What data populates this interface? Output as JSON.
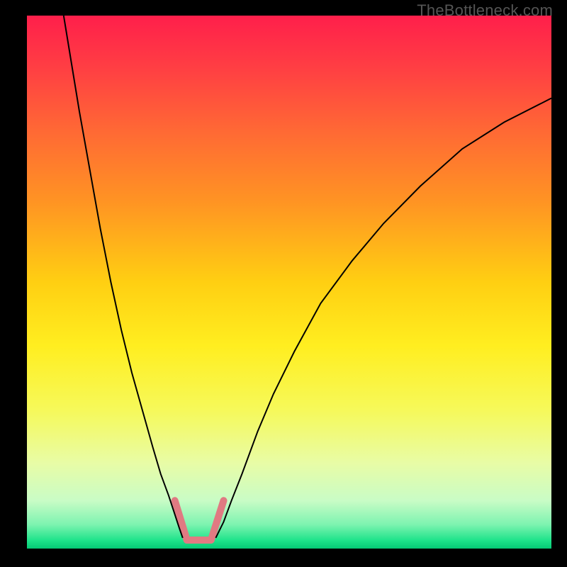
{
  "watermark": "TheBottleneck.com",
  "chart_data": {
    "type": "line",
    "title": "",
    "xlabel": "",
    "ylabel": "",
    "xlim": [
      0,
      100
    ],
    "ylim": [
      0,
      100
    ],
    "background": {
      "gradient_stops": [
        {
          "pos": 0.0,
          "color": "#ff1f4b"
        },
        {
          "pos": 0.1,
          "color": "#ff3f43"
        },
        {
          "pos": 0.22,
          "color": "#ff6a34"
        },
        {
          "pos": 0.35,
          "color": "#ff9423"
        },
        {
          "pos": 0.5,
          "color": "#ffcf12"
        },
        {
          "pos": 0.62,
          "color": "#ffee20"
        },
        {
          "pos": 0.74,
          "color": "#f6f95a"
        },
        {
          "pos": 0.84,
          "color": "#e8fca6"
        },
        {
          "pos": 0.91,
          "color": "#c9fcc6"
        },
        {
          "pos": 0.955,
          "color": "#7df3b0"
        },
        {
          "pos": 0.985,
          "color": "#1de38a"
        },
        {
          "pos": 1.0,
          "color": "#05c974"
        }
      ]
    },
    "series": [
      {
        "name": "left-curve",
        "stroke": "#000000",
        "x": [
          7.0,
          8.5,
          10.0,
          12.0,
          14.0,
          16.0,
          18.0,
          20.0,
          22.0,
          24.0,
          25.5,
          27.0,
          28.0,
          29.0,
          29.7
        ],
        "y": [
          100.0,
          91.0,
          82.0,
          71.0,
          60.0,
          50.0,
          41.0,
          33.0,
          26.0,
          19.0,
          14.0,
          10.0,
          7.0,
          4.0,
          2.0
        ]
      },
      {
        "name": "right-curve",
        "stroke": "#000000",
        "x": [
          36.0,
          37.5,
          39.0,
          41.0,
          44.0,
          47.0,
          51.0,
          56.0,
          62.0,
          68.0,
          75.0,
          83.0,
          91.0,
          100.0
        ],
        "y": [
          2.0,
          5.0,
          9.0,
          14.0,
          22.0,
          29.0,
          37.0,
          46.0,
          54.0,
          61.0,
          68.0,
          75.0,
          80.0,
          84.5
        ]
      },
      {
        "name": "valley-glow",
        "stroke": "#e07a82",
        "stroke_width": 10,
        "segments": [
          {
            "x": [
              28.2,
              30.5
            ],
            "y": [
              9.0,
              1.6
            ]
          },
          {
            "x": [
              30.5,
              35.1
            ],
            "y": [
              1.6,
              1.6
            ]
          },
          {
            "x": [
              35.1,
              37.5
            ],
            "y": [
              1.6,
              9.0
            ]
          }
        ]
      }
    ]
  }
}
